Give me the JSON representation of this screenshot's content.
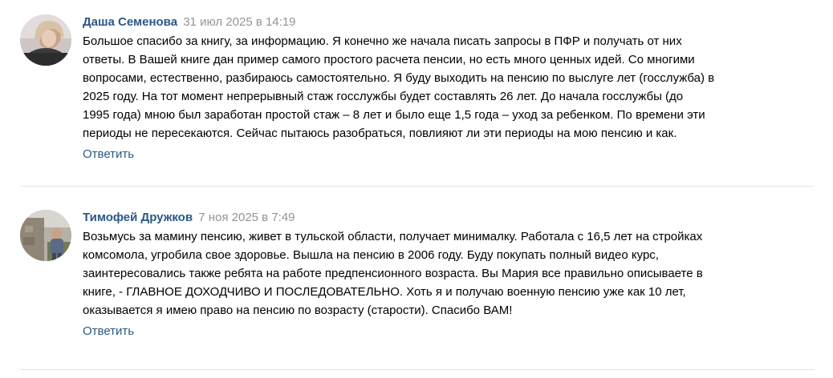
{
  "comments": [
    {
      "author": "Даша Семенова",
      "date": "31 июл 2025 в 14:19",
      "lines": [
        "Большое спасибо за книгу, за информацию. Я конечно же начала писать запросы в ПФР и получать от них",
        "ответы. В Вашей книге дан пример самого простого расчета пенсии, но есть много ценных идей. Со многими",
        "вопросами, естественно, разбираюсь самостоятельно. Я буду выходить на пенсию по выслуге лет (госслужба) в",
        "2025 году. На тот момент непрерывный стаж госслужбы будет составлять 26 лет. До начала госслужбы (до",
        "1995 года) мною был заработан простой стаж – 8 лет и было еще 1,5 года – уход за ребенком. По времени эти",
        "периоды не пересекаются. Сейчас пытаюсь разобраться, повлияют ли эти периоды на мою пенсию и как."
      ],
      "reply_label": "Ответить"
    },
    {
      "author": "Тимофей Дружков",
      "date": "7 ноя 2025 в 7:49",
      "lines": [
        "Возьмусь за мамину пенсию, живет в тульской области, получает минималку. Работала с 16,5 лет на стройках",
        "комсомола, угробила свое здоровье. Вышла на пенсию в 2006 году. Буду покупать полный видео курс,",
        "заинтересовались также ребята на работе предпенсионного возраста. Вы Мария все правильно описываете в",
        "книге, - ГЛАВНОЕ ДОХОДЧИВО И ПОСЛЕДОВАТЕЛЬНО. Хоть я и получаю военную пенсию уже как 10 лет,",
        "оказывается я имею право на пенсию по возрасту (старости). Спасибо ВАМ!"
      ],
      "reply_label": "Ответить"
    }
  ],
  "colors": {
    "link": "#2a5885",
    "date": "#939393",
    "text": "#000000",
    "divider": "#e3e4e8"
  }
}
